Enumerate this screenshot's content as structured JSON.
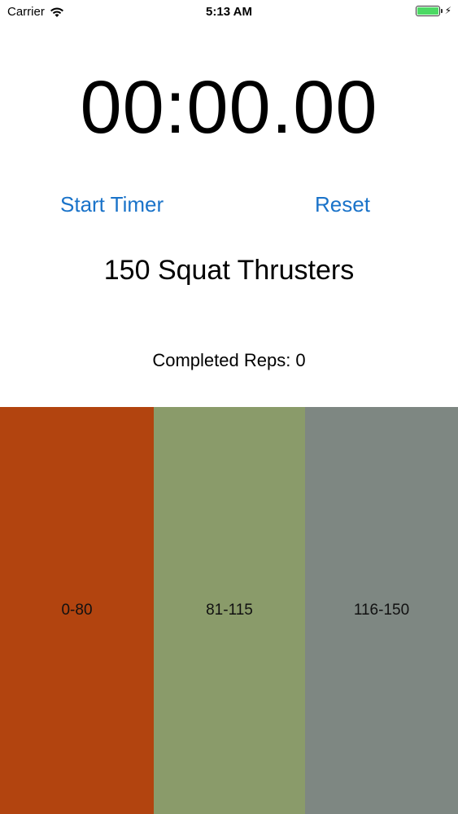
{
  "status_bar": {
    "carrier": "Carrier",
    "time": "5:13 AM",
    "wifi_icon": "wifi-icon",
    "battery_icon": "battery-icon",
    "charging_icon": "bolt-icon",
    "battery_level": 1.0
  },
  "timer": {
    "display": "00:00.00"
  },
  "controls": {
    "start_label": "Start Timer",
    "reset_label": "Reset",
    "accent_color": "#1a73c9"
  },
  "workout": {
    "exercise": "150 Squat Thrusters",
    "completed_reps": "Completed Reps: 0"
  },
  "ranges": [
    {
      "label": "0-80",
      "color": "#b2440f"
    },
    {
      "label": "81-115",
      "color": "#8a9b6a"
    },
    {
      "label": "116-150",
      "color": "#7e8782"
    }
  ]
}
